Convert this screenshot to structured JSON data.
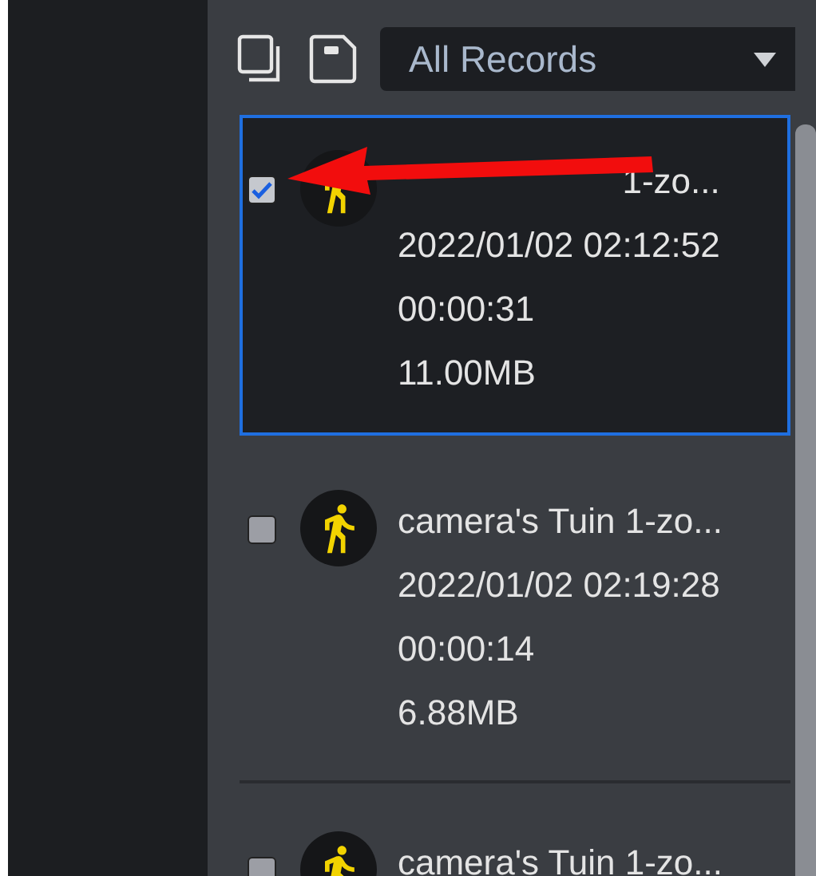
{
  "toolbar": {
    "filter": {
      "value": "All Records"
    }
  },
  "records": [
    {
      "title": "1-zo...",
      "datetime": "2022/01/02 02:12:52",
      "duration": "00:00:31",
      "size": "11.00MB",
      "checked": true,
      "selected": true
    },
    {
      "title": "camera's Tuin 1-zo...",
      "datetime": "2022/01/02 02:19:28",
      "duration": "00:00:14",
      "size": "6.88MB",
      "checked": false,
      "selected": false
    },
    {
      "title": "camera's Tuin 1-zo...",
      "checked": false,
      "selected": false
    }
  ]
}
